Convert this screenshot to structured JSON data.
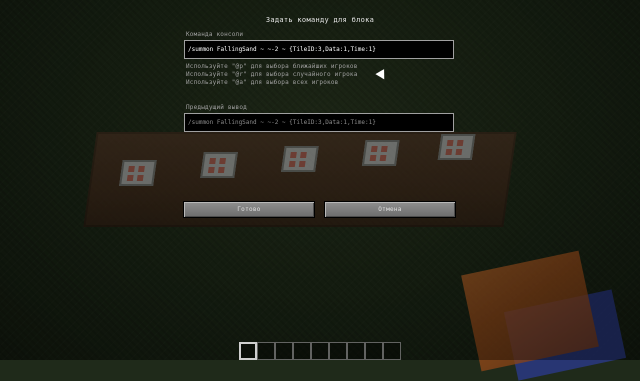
{
  "screen": {
    "title": "Задать команду для блока"
  },
  "console": {
    "label": "Команда консоли",
    "value": "/summon FallingSand ~ ~-2 ~ {TileID:3,Data:1,Time:1}"
  },
  "hints": [
    "Используйте \"@p\" для выбора ближайших игроков",
    "Используйте \"@r\" для выбора случайного игрока",
    "Используйте \"@a\" для выбора всех игроков"
  ],
  "previous": {
    "label": "Предыдущий вывод",
    "value": "/summon FallingSand ~ ~-2 ~ {TileID:3,Data:1,Time:1}"
  },
  "buttons": {
    "done": "Готово",
    "cancel": "Отмена"
  },
  "hotbar": {
    "slots": 9,
    "selected_index": 0
  },
  "colors": {
    "field_bg": "#000000",
    "field_border": "#a0a0a0",
    "button_face": "#7a7a7a",
    "text": "#e0e0e0"
  },
  "icons": {
    "command_block": "command-block-icon",
    "hand": "player-hand-icon",
    "cursor": "mouse-cursor-icon"
  }
}
